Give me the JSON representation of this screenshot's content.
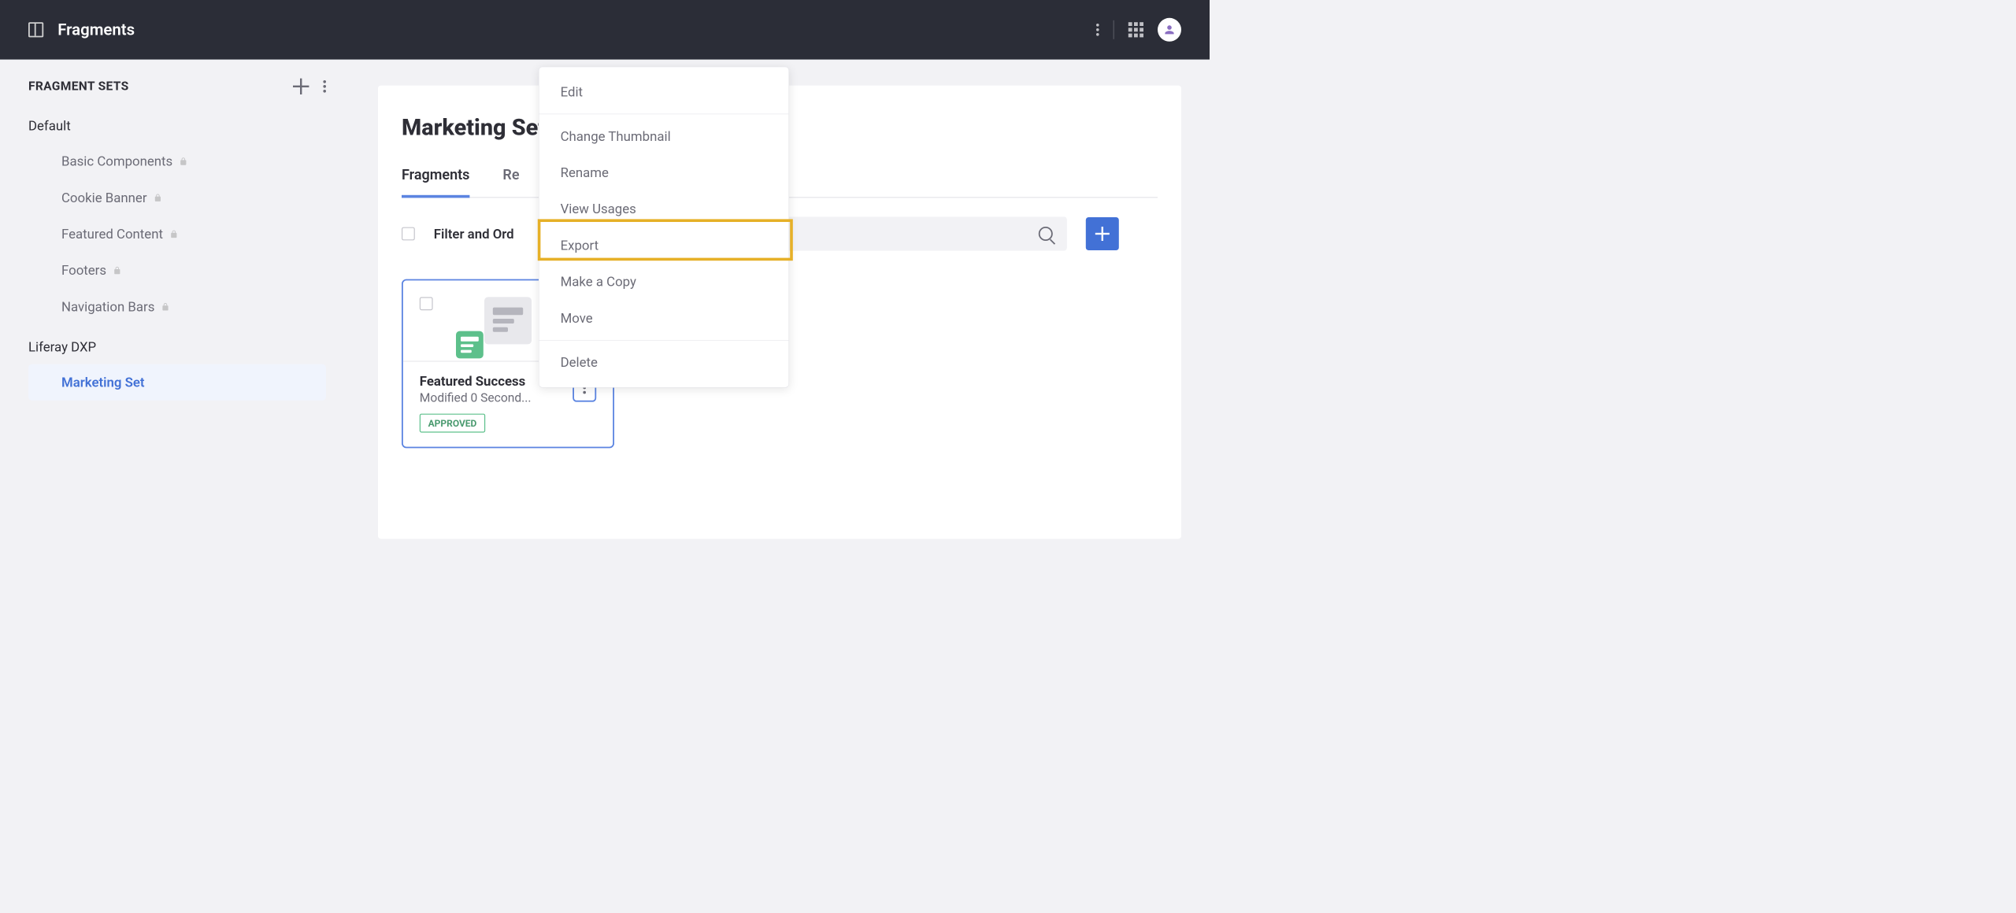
{
  "topbar": {
    "title": "Fragments"
  },
  "sidebar": {
    "title": "FRAGMENT SETS",
    "groups": [
      {
        "label": "Default",
        "items": [
          {
            "label": "Basic Components",
            "locked": true
          },
          {
            "label": "Cookie Banner",
            "locked": true
          },
          {
            "label": "Featured Content",
            "locked": true
          },
          {
            "label": "Footers",
            "locked": true
          },
          {
            "label": "Navigation Bars",
            "locked": true
          }
        ]
      },
      {
        "label": "Liferay DXP",
        "items": [
          {
            "label": "Marketing Set",
            "locked": false,
            "active": true
          }
        ]
      }
    ]
  },
  "panel": {
    "title": "Marketing Set",
    "tabs": [
      {
        "label": "Fragments",
        "active": true
      },
      {
        "label": "Re"
      }
    ],
    "filter_label": "Filter and Ord",
    "card": {
      "title": "Featured Success",
      "meta": "Modified 0 Second...",
      "status": "APPROVED"
    }
  },
  "dropdown": {
    "items": [
      "Edit",
      "Change Thumbnail",
      "Rename",
      "View Usages",
      "Export",
      "Make a Copy",
      "Move",
      "Delete"
    ]
  }
}
